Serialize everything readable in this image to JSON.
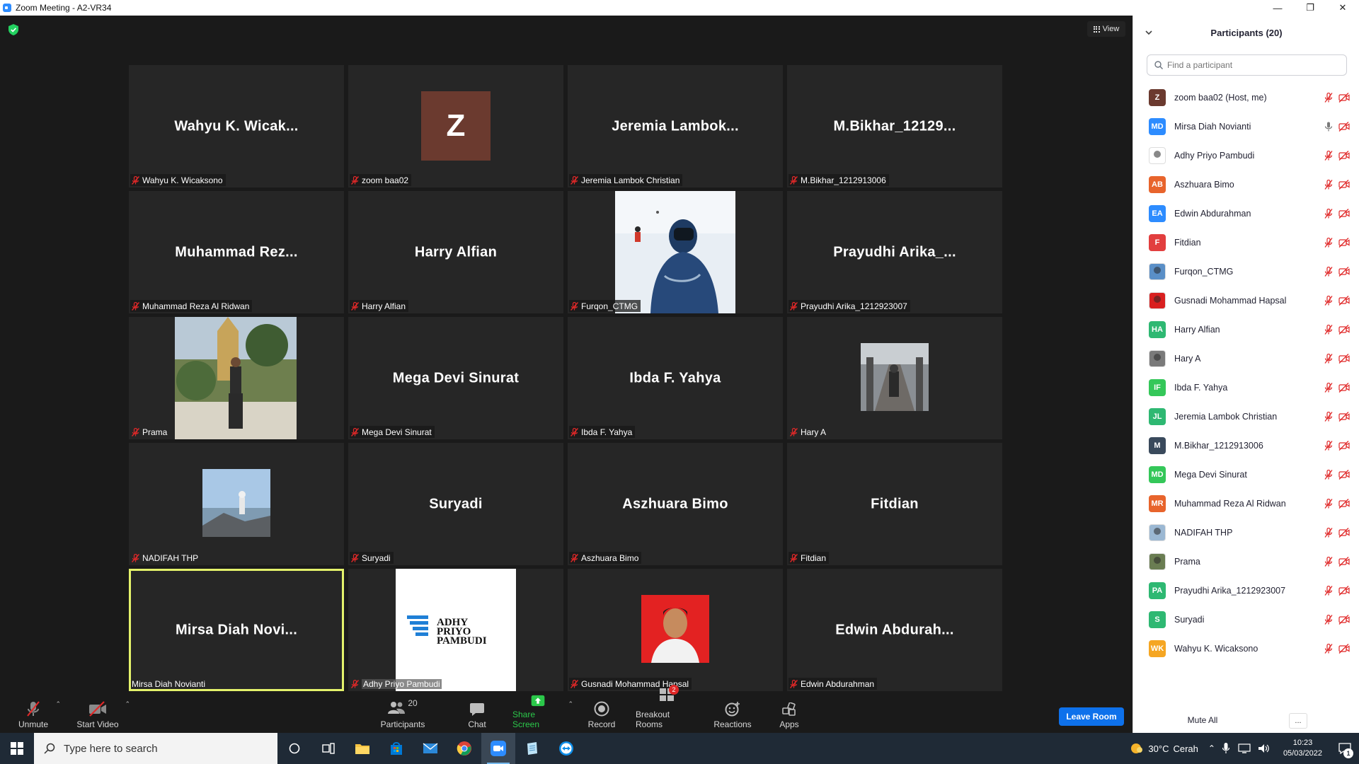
{
  "window": {
    "title": "Zoom Meeting - A2-VR34"
  },
  "view_button": {
    "label": "View"
  },
  "tiles": [
    {
      "big": "Wahyu  K.  Wicak...",
      "label": "Wahyu K. Wicaksono",
      "kind": "name"
    },
    {
      "big": "Z",
      "label": "zoom baa02",
      "kind": "avatar"
    },
    {
      "big": "Jeremia  Lambok...",
      "label": "Jeremia Lambok Christian",
      "kind": "name"
    },
    {
      "big": "M.Bikhar_12129...",
      "label": "M.Bikhar_1212913006",
      "kind": "name"
    },
    {
      "big": "Muhammad  Rez...",
      "label": "Muhammad Reza Al Ridwan",
      "kind": "name"
    },
    {
      "big": "Harry Alfian",
      "label": "Harry Alfian",
      "kind": "name"
    },
    {
      "big": "",
      "label": "Furqon_CTMG",
      "kind": "photo"
    },
    {
      "big": "Prayudhi  Arika_...",
      "label": "Prayudhi Arika_1212923007",
      "kind": "name"
    },
    {
      "big": "",
      "label": "Prama",
      "kind": "photo"
    },
    {
      "big": "Mega Devi Sinurat",
      "label": "Mega Devi Sinurat",
      "kind": "name"
    },
    {
      "big": "Ibda F. Yahya",
      "label": "Ibda F. Yahya",
      "kind": "name"
    },
    {
      "big": "",
      "label": "Hary A",
      "kind": "photo"
    },
    {
      "big": "",
      "label": "NADIFAH THP",
      "kind": "photo"
    },
    {
      "big": "Suryadi",
      "label": "Suryadi",
      "kind": "name"
    },
    {
      "big": "Aszhuara Bimo",
      "label": "Aszhuara Bimo",
      "kind": "name"
    },
    {
      "big": "Fitdian",
      "label": "Fitdian",
      "kind": "name"
    },
    {
      "big": "Mirsa  Diah  Novi...",
      "label": "Mirsa Diah Novianti",
      "kind": "name",
      "active": true
    },
    {
      "big": "",
      "label": "Adhy Priyo Pambudi",
      "kind": "photo",
      "logo_text": [
        "ADHY",
        "PRIYO",
        "PAMBUDI"
      ]
    },
    {
      "big": "",
      "label": "Gusnadi Mohammad Hapsal",
      "kind": "photo"
    },
    {
      "big": "Edwin  Abdurah...",
      "label": "Edwin Abdurahman",
      "kind": "name"
    }
  ],
  "toolbar": {
    "unmute": "Unmute",
    "start_video": "Start Video",
    "participants": "Participants",
    "participants_count": "20",
    "chat": "Chat",
    "share_screen": "Share Screen",
    "record": "Record",
    "breakout_rooms": "Breakout Rooms",
    "breakout_badge": "2",
    "reactions": "Reactions",
    "apps": "Apps",
    "leave": "Leave Room"
  },
  "panel": {
    "title": "Participants (20)",
    "search_placeholder": "Find a participant",
    "participants": [
      {
        "initials": "Z",
        "name": "zoom baa02 (Host, me)",
        "color": "#6b3a2f"
      },
      {
        "initials": "MD",
        "name": "Mirsa Diah Novianti",
        "color": "#2d8cff",
        "mic_on": true
      },
      {
        "initials": "",
        "name": "Adhy Priyo Pambudi",
        "color": "#ffffff",
        "photo": true
      },
      {
        "initials": "AB",
        "name": "Aszhuara Bimo",
        "color": "#e8642c"
      },
      {
        "initials": "EA",
        "name": "Edwin Abdurahman",
        "color": "#2d8cff"
      },
      {
        "initials": "F",
        "name": "Fitdian",
        "color": "#e23e3e"
      },
      {
        "initials": "",
        "name": "Furqon_CTMG",
        "color": "#5a8fc7",
        "photo": true
      },
      {
        "initials": "",
        "name": "Gusnadi Mohammad Hapsal",
        "color": "#d92020",
        "photo": true
      },
      {
        "initials": "HA",
        "name": "Harry Alfian",
        "color": "#2eb872"
      },
      {
        "initials": "",
        "name": "Hary A",
        "color": "#7a7a7a",
        "photo": true
      },
      {
        "initials": "IF",
        "name": "Ibda F. Yahya",
        "color": "#34c759"
      },
      {
        "initials": "JL",
        "name": "Jeremia Lambok Christian",
        "color": "#2eb872"
      },
      {
        "initials": "M",
        "name": "M.Bikhar_1212913006",
        "color": "#3a4a5c"
      },
      {
        "initials": "MD",
        "name": "Mega Devi Sinurat",
        "color": "#34c759"
      },
      {
        "initials": "MR",
        "name": "Muhammad Reza Al Ridwan",
        "color": "#e8642c"
      },
      {
        "initials": "",
        "name": "NADIFAH THP",
        "color": "#9bb8d3",
        "photo": true
      },
      {
        "initials": "",
        "name": "Prama",
        "color": "#6a7d52",
        "photo": true
      },
      {
        "initials": "PA",
        "name": "Prayudhi Arika_1212923007",
        "color": "#2eb872"
      },
      {
        "initials": "S",
        "name": "Suryadi",
        "color": "#2eb872"
      },
      {
        "initials": "WK",
        "name": "Wahyu K. Wicaksono",
        "color": "#f5a623"
      }
    ],
    "mute_all": "Mute All",
    "more": "..."
  },
  "taskbar": {
    "search_placeholder": "Type here to search",
    "weather_temp": "30°C",
    "weather_text": "Cerah",
    "time": "10:23",
    "date": "05/03/2022",
    "notifications": "1"
  },
  "colors": {
    "accent": "#0e71eb",
    "active_speaker": "#e4f26b",
    "muted": "#e02828",
    "share": "#2bc84a"
  }
}
